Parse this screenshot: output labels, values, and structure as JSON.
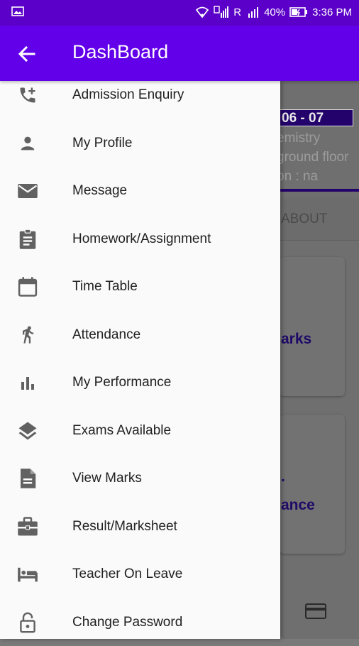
{
  "status_bar": {
    "gallery_icon": "image-icon",
    "signal_label": "R",
    "battery": "40%",
    "time": "3:36 PM"
  },
  "app_bar": {
    "title": "DashBoard",
    "back_icon": "arrow-back-icon"
  },
  "drawer": {
    "items": [
      {
        "label": "Admission Enquiry",
        "icon": "phone-add-icon"
      },
      {
        "label": "My Profile",
        "icon": "person-icon"
      },
      {
        "label": "Message",
        "icon": "mail-icon"
      },
      {
        "label": "Homework/Assignment",
        "icon": "clipboard-icon"
      },
      {
        "label": "Time Table",
        "icon": "calendar-icon"
      },
      {
        "label": "Attendance",
        "icon": "running-person-icon"
      },
      {
        "label": "My Performance",
        "icon": "bar-chart-icon"
      },
      {
        "label": "Exams Available",
        "icon": "layers-icon"
      },
      {
        "label": "View Marks",
        "icon": "document-icon"
      },
      {
        "label": "Result/Marksheet",
        "icon": "briefcase-icon"
      },
      {
        "label": "Teacher On Leave",
        "icon": "bed-icon"
      },
      {
        "label": "Change Password",
        "icon": "lock-icon"
      }
    ]
  },
  "background": {
    "date": "06 - 07",
    "line1": "emistry",
    "line2": "ground floor",
    "line3": "on : na",
    "tab": "ABOUT",
    "card1": "arks",
    "card2_top": ".",
    "card2": "ance"
  }
}
